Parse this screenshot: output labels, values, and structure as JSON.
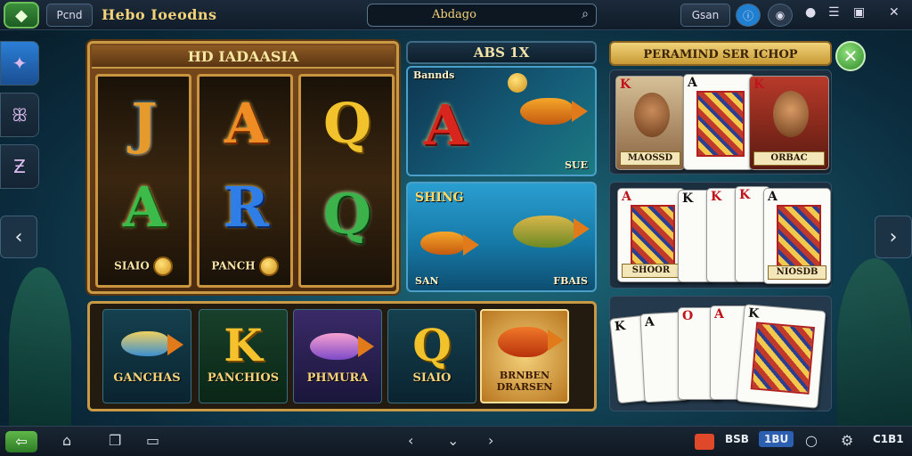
{
  "topbar": {
    "back_label": "Pcnd",
    "title": "Hebo Ioeodns",
    "search_value": "Abdago",
    "account_label": "Gsan"
  },
  "slots": {
    "header": "HD IADAASIA",
    "reel1_label": "SIAIO",
    "reel2_label": "PANCH",
    "glyphs": [
      "J",
      "A",
      "R",
      "Q",
      "A",
      "Q"
    ]
  },
  "fish": {
    "header": "ABS 1X",
    "panel1_tag": "Bannds",
    "panel1_corner": "SUE",
    "panel1_glyph": "A",
    "panel2_title": "SHING",
    "panel2_left": "SAN",
    "panel2_right": "FBAIS"
  },
  "tiles": [
    {
      "label": "GANCHAS",
      "glyph": ""
    },
    {
      "label": "PANCHIOS",
      "glyph": "K"
    },
    {
      "label": "PHMURA",
      "glyph": ""
    },
    {
      "label": "SIAIO",
      "glyph": "Q"
    },
    {
      "label": "BRNBEN DRARSEN",
      "glyph": ""
    }
  ],
  "cards": {
    "header": "PERAMIND SER ICHOP",
    "row1_labels": [
      "MAOSSD",
      "ORBAC"
    ],
    "row2_labels": [
      "SHOOR",
      "NIOSDB"
    ],
    "ranks": [
      "K",
      "A",
      "K",
      "A",
      "K",
      "K",
      "K",
      "A",
      "K",
      "A",
      "O",
      "K"
    ]
  },
  "bottombar": {
    "num1": "BSB",
    "num2": "1BU",
    "num3": "C1B1"
  }
}
